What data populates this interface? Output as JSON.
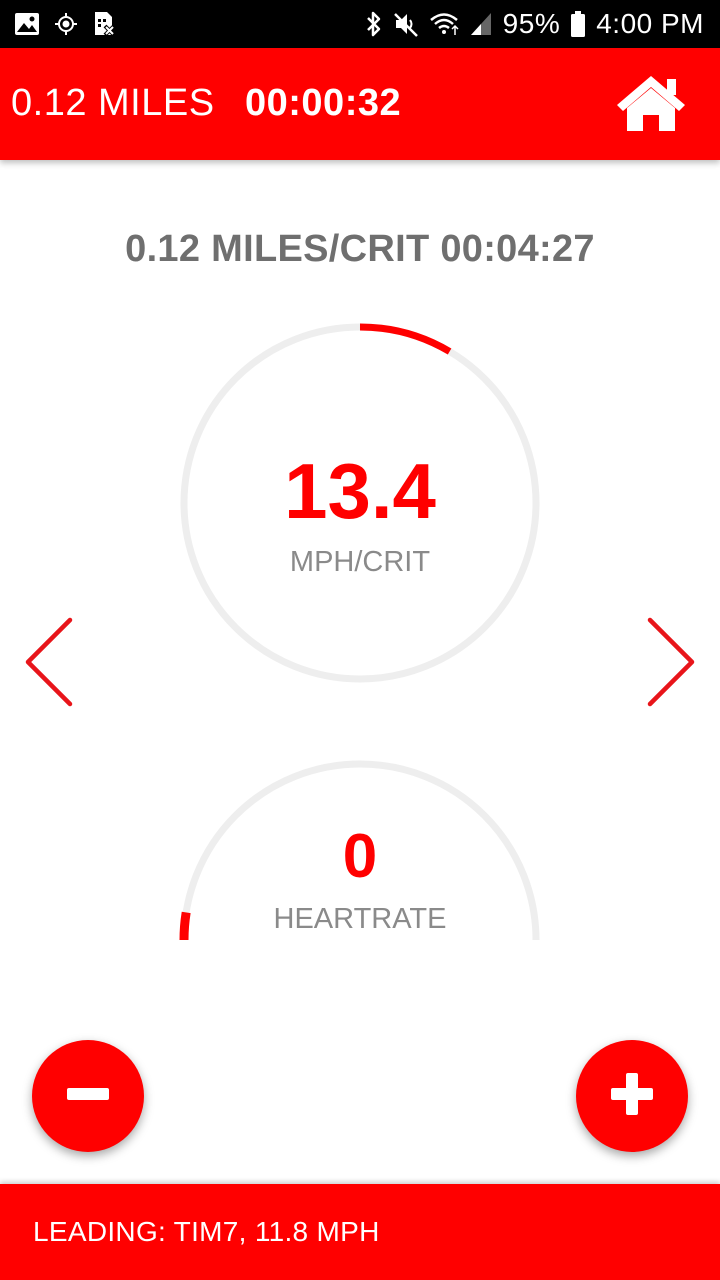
{
  "status_bar": {
    "icons_left": [
      "image-icon",
      "gps-icon",
      "sim-card-off-icon"
    ],
    "icons_right": [
      "bluetooth-icon",
      "mute-icon",
      "wifi-icon",
      "cell-signal-icon",
      "battery-icon"
    ],
    "battery": "95%",
    "time": "4:00 PM"
  },
  "header": {
    "distance": "0.12 MILES",
    "elapsed": "00:00:32",
    "home_icon": "home-icon"
  },
  "lap_title": "0.12 MILES/CRIT 00:04:27",
  "speed_gauge": {
    "value": "13.4",
    "unit": "MPH/CRIT",
    "progress_fraction": 0.085
  },
  "heartrate_gauge": {
    "value": "0",
    "unit": "HEARTRATE",
    "progress_fraction": 0.05
  },
  "navigation": {
    "prev_icon": "chevron-left-icon",
    "next_icon": "chevron-right-icon"
  },
  "actions": {
    "minus_icon": "minus-icon",
    "plus_icon": "plus-icon"
  },
  "footer": {
    "leading": "LEADING: TIM7, 11.8 MPH"
  },
  "colors": {
    "accent": "#ff0000",
    "track": "#eeeeee",
    "title_gray": "#6f6f6f",
    "label_gray": "#8a8a8a"
  }
}
